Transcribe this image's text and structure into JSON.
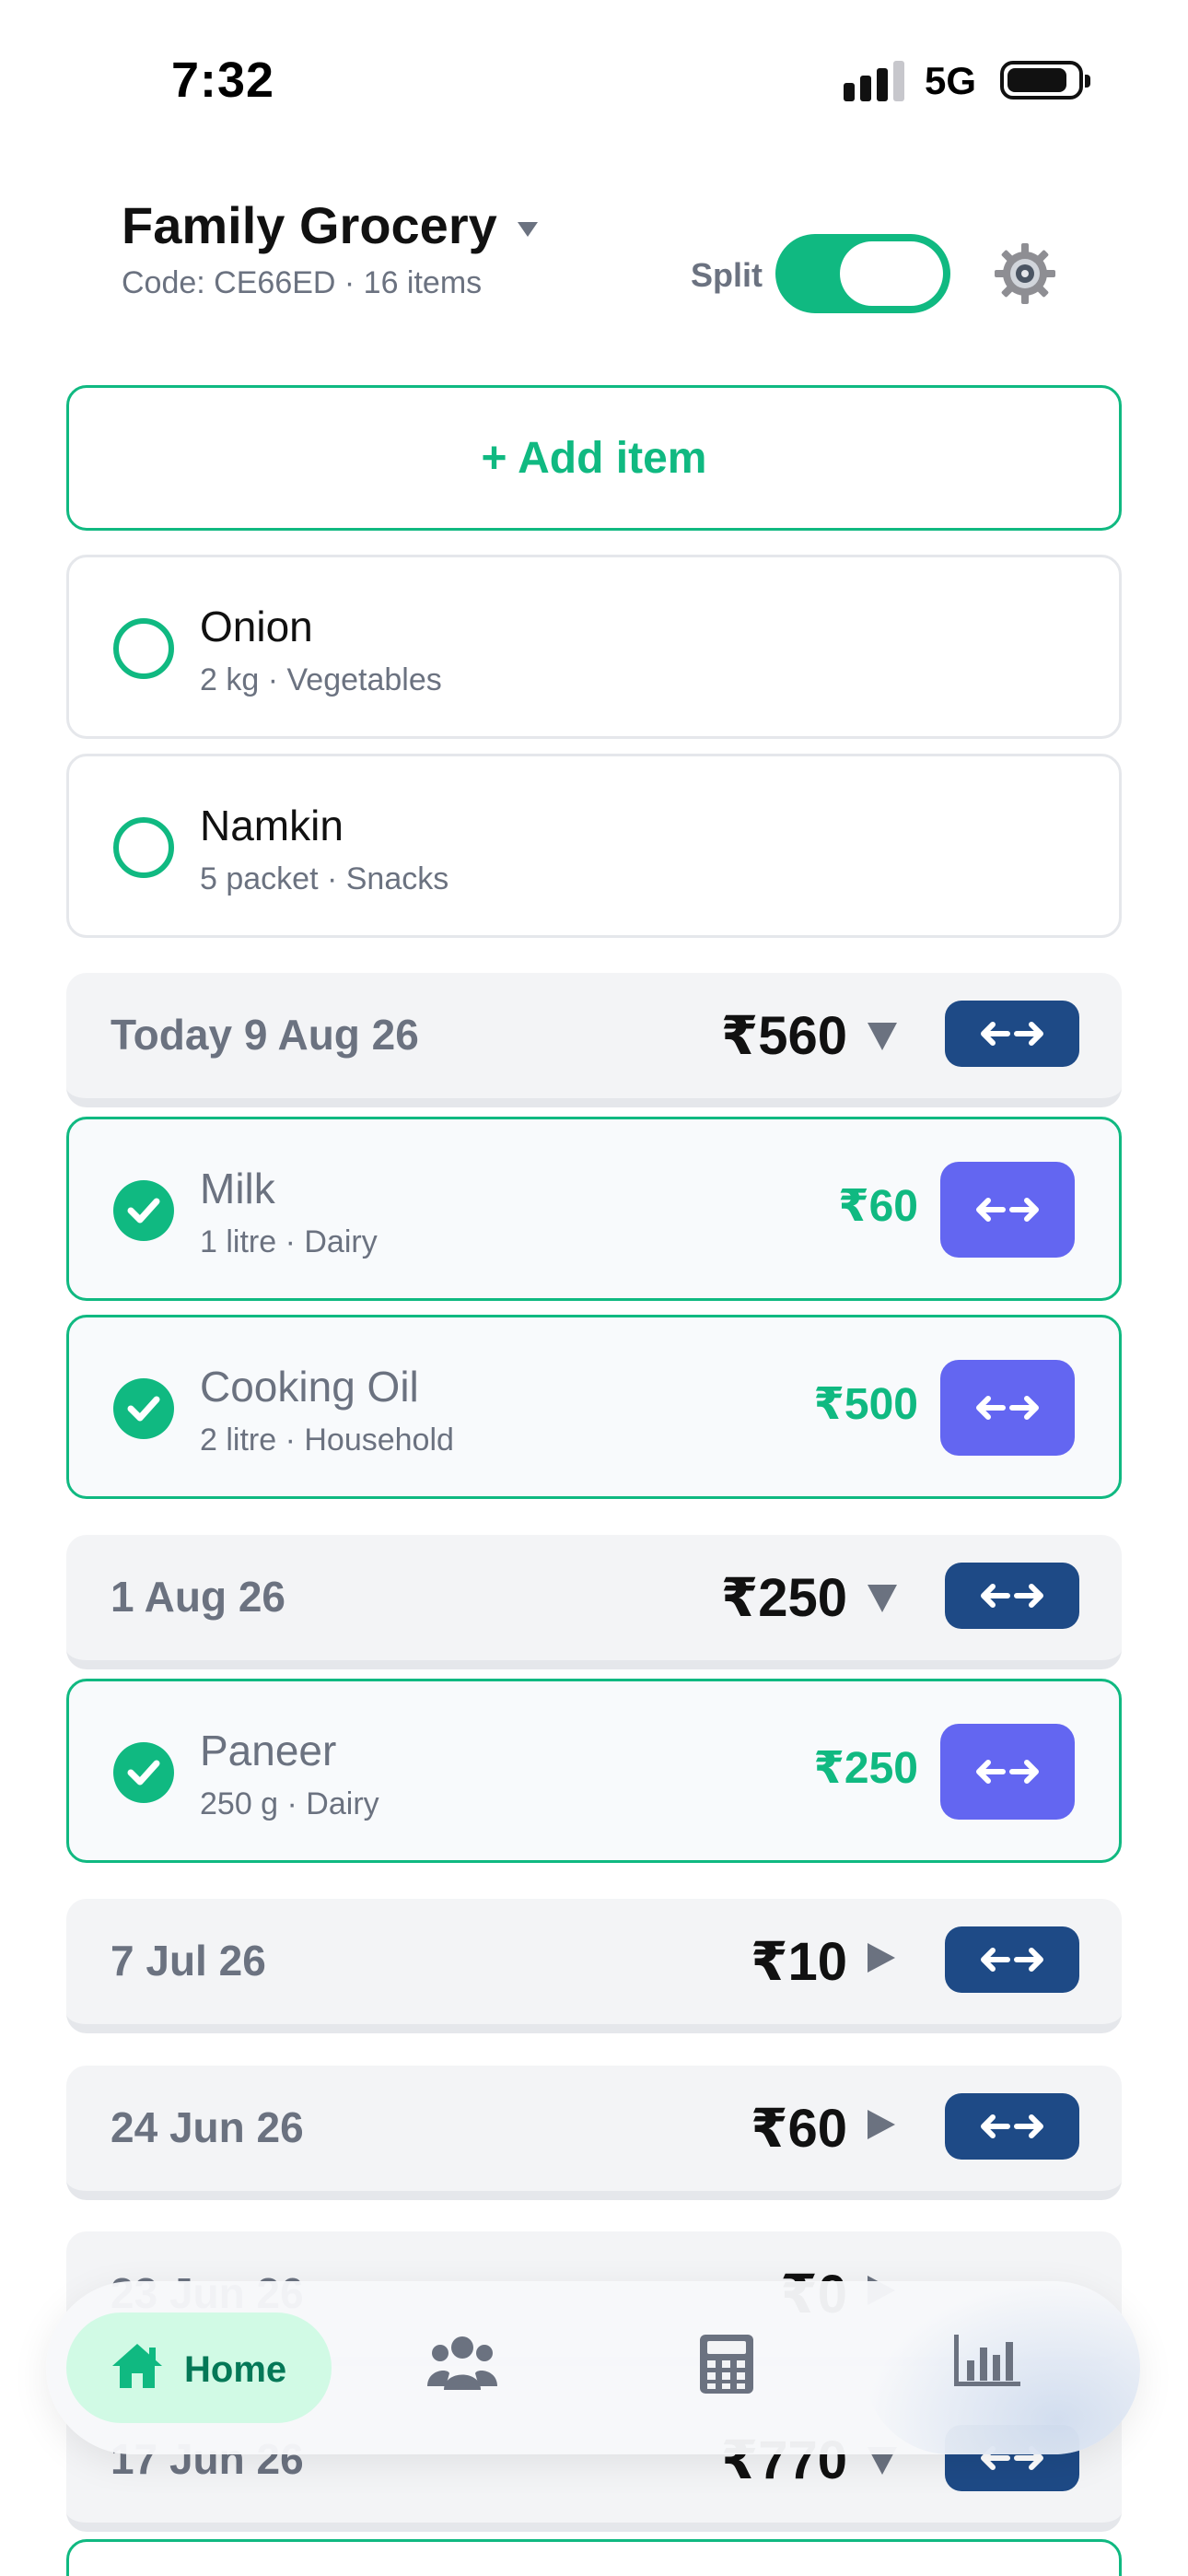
{
  "status_bar": {
    "time": "7:32",
    "network": "5G"
  },
  "header": {
    "title": "Family Grocery",
    "subtitle": "Code: CE66ED · 16 items",
    "split_label": "Split",
    "split_on": true
  },
  "add_item_label": "+ Add item",
  "open_items": [
    {
      "name": "Onion",
      "meta": "2 kg · Vegetables"
    },
    {
      "name": "Namkin",
      "meta": "5 packet · Snacks"
    }
  ],
  "groups": [
    {
      "date": "Today 9 Aug 26",
      "total": "₹560",
      "expanded": true,
      "items": [
        {
          "name": "Milk",
          "meta": "1 litre · Dairy",
          "price": "₹60"
        },
        {
          "name": "Cooking Oil",
          "meta": "2 litre · Household",
          "price": "₹500"
        }
      ]
    },
    {
      "date": "1 Aug 26",
      "total": "₹250",
      "expanded": true,
      "items": [
        {
          "name": "Paneer",
          "meta": "250 g · Dairy",
          "price": "₹250"
        }
      ]
    },
    {
      "date": "7 Jul 26",
      "total": "₹10",
      "expanded": false
    },
    {
      "date": "24 Jun 26",
      "total": "₹60",
      "expanded": false
    },
    {
      "date": "23 Jun 26",
      "total": "₹0",
      "expanded": false
    },
    {
      "date": "17 Jun 26",
      "total": "₹770",
      "expanded": true
    }
  ],
  "tab_bar": {
    "tabs": [
      {
        "label": "Home",
        "icon": "home-icon",
        "active": true
      },
      {
        "label": "",
        "icon": "people-icon",
        "active": false
      },
      {
        "label": "",
        "icon": "calculator-icon",
        "active": false
      },
      {
        "label": "",
        "icon": "bar-chart-icon",
        "active": false
      }
    ]
  },
  "colors": {
    "accent": "#10b981",
    "swap_button": "#6366f1",
    "swap_button_group": "#1e4a86",
    "group_bg": "#f3f4f6"
  }
}
